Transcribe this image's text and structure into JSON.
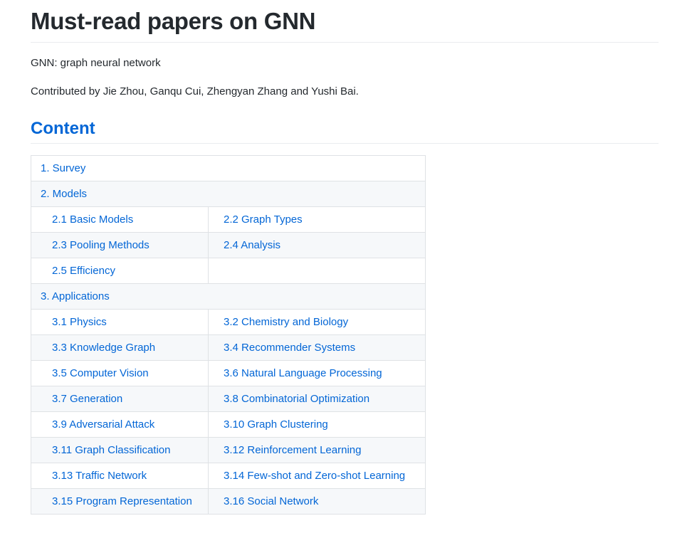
{
  "readme": {
    "title": "Must-read papers on GNN",
    "intro": "GNN: graph neural network",
    "contributors": "Contributed by Jie Zhou, Ganqu Cui, Zhengyan Zhang and Yushi Bai.",
    "content_heading": "Content"
  },
  "toc": {
    "survey": "1. Survey",
    "models": "2. Models",
    "models_items": [
      "2.1 Basic Models",
      "2.2 Graph Types",
      "2.3 Pooling Methods",
      "2.4 Analysis",
      "2.5 Efficiency"
    ],
    "applications": "3. Applications",
    "applications_items": [
      "3.1 Physics",
      "3.2 Chemistry and Biology",
      "3.3 Knowledge Graph",
      "3.4 Recommender Systems",
      "3.5 Computer Vision",
      "3.6 Natural Language Processing",
      "3.7 Generation",
      "3.8 Combinatorial Optimization",
      "3.9 Adversarial Attack",
      "3.10 Graph Clustering",
      "3.11 Graph Classification",
      "3.12 Reinforcement Learning",
      "3.13 Traffic Network",
      "3.14 Few-shot and Zero-shot Learning",
      "3.15 Program Representation",
      "3.16 Social Network"
    ]
  },
  "colors": {
    "link": "#0366d6",
    "text": "#24292e",
    "border": "#dfe2e5",
    "row_alt": "#f6f8fa",
    "rule": "#eaecef"
  }
}
